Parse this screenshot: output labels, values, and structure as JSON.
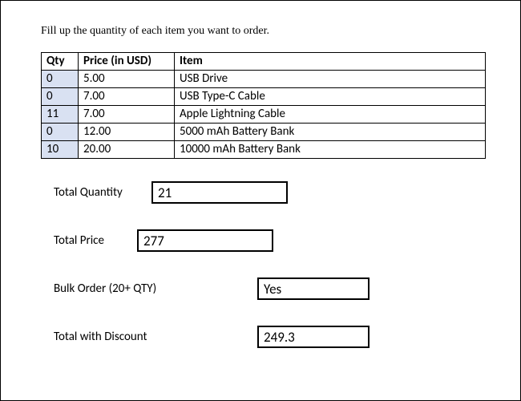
{
  "instruction": "Fill up the quantity of each item you want to order.",
  "table": {
    "headers": {
      "qty": "Qty",
      "price": "Price (in USD)",
      "item": "Item"
    },
    "rows": [
      {
        "qty": "0",
        "price": "5.00",
        "item": "USB Drive"
      },
      {
        "qty": "0",
        "price": "7.00",
        "item": "USB Type-C Cable"
      },
      {
        "qty": "11",
        "price": "7.00",
        "item": "Apple Lightning Cable"
      },
      {
        "qty": "0",
        "price": "12.00",
        "item": "5000 mAh Battery Bank"
      },
      {
        "qty": "10",
        "price": "20.00",
        "item": "10000 mAh Battery Bank"
      }
    ]
  },
  "summary": {
    "total_qty": {
      "label": "Total Quantity",
      "value": "21"
    },
    "total_price": {
      "label": "Total Price",
      "value": "277"
    },
    "bulk": {
      "label": "Bulk Order (20+ QTY)",
      "value": "Yes"
    },
    "discount": {
      "label": "Total with Discount",
      "value": "249.3"
    }
  }
}
